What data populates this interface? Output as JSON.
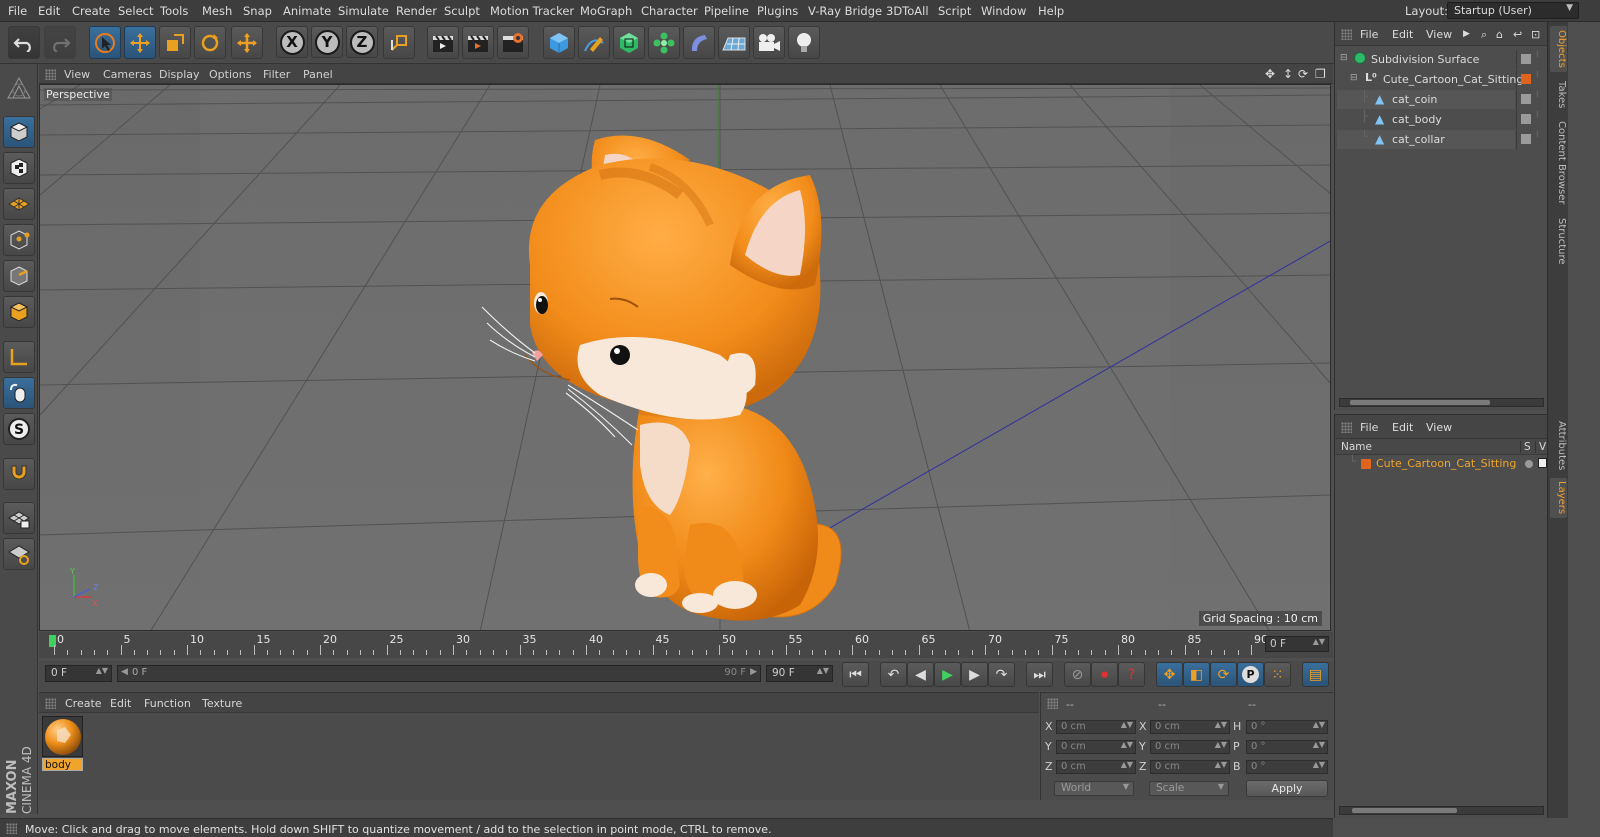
{
  "menu": [
    "File",
    "Edit",
    "Create",
    "Select",
    "Tools",
    "Mesh",
    "Snap",
    "Animate",
    "Simulate",
    "Render",
    "Sculpt",
    "Motion Tracker",
    "MoGraph",
    "Character",
    "Pipeline",
    "Plugins",
    "V-Ray Bridge",
    "3DToAll",
    "Script",
    "Window",
    "Help"
  ],
  "layout": {
    "label": "Layout:",
    "value": "Startup (User)"
  },
  "toolbar": {
    "axis_x": "X",
    "axis_y": "Y",
    "axis_z": "Z"
  },
  "viewport": {
    "menu": [
      "View",
      "Cameras",
      "Display",
      "Options",
      "Filter",
      "Panel"
    ],
    "camera_label": "Perspective",
    "grid_spacing": "Grid Spacing : 10 cm"
  },
  "timeline": {
    "ticks": [
      "0",
      "5",
      "10",
      "15",
      "20",
      "25",
      "30",
      "35",
      "40",
      "45",
      "50",
      "55",
      "60",
      "65",
      "70",
      "75",
      "80",
      "85",
      "90"
    ],
    "current_frame": "0 F"
  },
  "playback": {
    "start_field": "0 F",
    "slider_start": "0 F",
    "slider_end": "90 F",
    "end_field": "90 F"
  },
  "materials": {
    "menu": [
      "Create",
      "Edit",
      "Function",
      "Texture"
    ],
    "items": [
      {
        "name": "body"
      }
    ]
  },
  "coordinates": {
    "headers": [
      "--",
      "--",
      "--"
    ],
    "rows": [
      {
        "l1": "X",
        "v1": "0 cm",
        "l2": "X",
        "v2": "0 cm",
        "l3": "H",
        "v3": "0 °"
      },
      {
        "l1": "Y",
        "v1": "0 cm",
        "l2": "Y",
        "v2": "0 cm",
        "l3": "P",
        "v3": "0 °"
      },
      {
        "l1": "Z",
        "v1": "0 cm",
        "l2": "Z",
        "v2": "0 cm",
        "l3": "B",
        "v3": "0 °"
      }
    ],
    "mode": "World",
    "scale_mode": "Scale",
    "apply": "Apply"
  },
  "status": "Move: Click and drag to move elements. Hold down SHIFT to quantize movement / add to the selection in point mode, CTRL to remove.",
  "objects_panel": {
    "menu": [
      "File",
      "Edit",
      "View"
    ],
    "items": [
      {
        "name": "Subdivision Surface"
      },
      {
        "name": "Cute_Cartoon_Cat_Sitting"
      },
      {
        "name": "cat_coin"
      },
      {
        "name": "cat_body"
      },
      {
        "name": "cat_collar"
      }
    ]
  },
  "layers_panel": {
    "menu": [
      "File",
      "Edit",
      "View"
    ],
    "col_name": "Name",
    "col_s": "S",
    "col_v": "V",
    "items": [
      {
        "name": "Cute_Cartoon_Cat_Sitting",
        "color": "#e0641e"
      }
    ]
  },
  "side_tabs": [
    "Objects",
    "Takes",
    "Content Browser",
    "Structure",
    "Attributes",
    "Layers"
  ],
  "brand": {
    "maxon": "MAXON",
    "cinema": "CINEMA 4D"
  },
  "colors": {
    "accent_orange": "#f1a42b",
    "active_blue": "#2f5f8a",
    "cat_orange": "#f08c1e"
  }
}
